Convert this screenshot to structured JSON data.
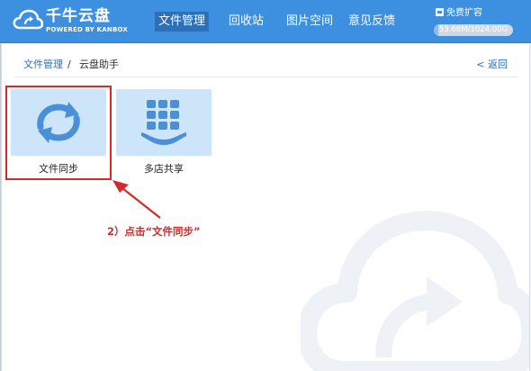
{
  "brand": {
    "title": "千牛云盘",
    "subtitle": "POWERED BY KANBOX"
  },
  "nav": {
    "items": [
      {
        "label": "文件管理",
        "active": true
      },
      {
        "label": "回收站",
        "active": false
      },
      {
        "label": "图片空间",
        "active": false
      },
      {
        "label": "意见反馈",
        "active": false
      }
    ]
  },
  "storage": {
    "expand_label": "免费扩容",
    "usage_text": "53.68M/1024.00G",
    "used_fraction": 5e-05
  },
  "breadcrumb": {
    "root": "文件管理",
    "separator": "/",
    "current": "云盘助手",
    "back_label": "< 返回"
  },
  "tiles": [
    {
      "label": "文件同步",
      "icon": "sync-icon"
    },
    {
      "label": "多店共享",
      "icon": "share-grid-icon"
    }
  ],
  "annotation": {
    "text": "2）点击“文件同步”",
    "color": "#d42a2a"
  },
  "colors": {
    "header": "#3d8fe0",
    "nav_active": "#2d6fb8",
    "tile_bg": "#cde5f8",
    "icon": "#4a90d8",
    "annotation": "#d42a2a"
  }
}
